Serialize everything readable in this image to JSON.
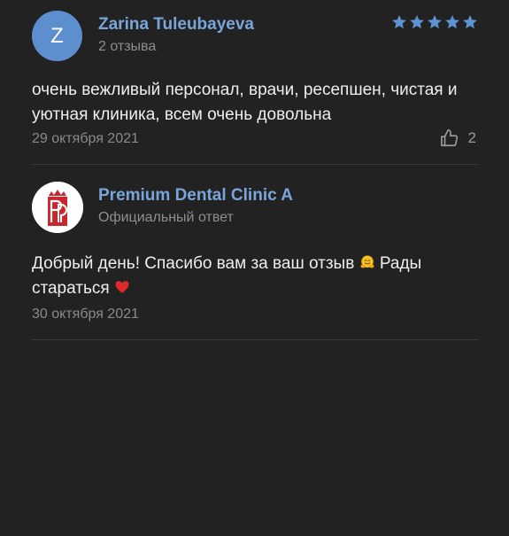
{
  "review": {
    "avatar_letter": "Z",
    "author": "Zarina Tuleubayeva",
    "author_reviews": "2 отзыва",
    "rating": 5,
    "text": "очень вежливый персонал, врачи, ресепшен, чистая и уютная клиника, всем очень довольна",
    "date": "29 октября 2021",
    "likes": "2"
  },
  "reply": {
    "author": "Premium Dental Clinic A",
    "subtitle": "Официальный ответ",
    "text_part1": "Добрый день! Спасибо вам за ваш отзыв",
    "text_part2": "Рады стараться",
    "date": "30 октября 2021"
  },
  "colors": {
    "background": "#222222",
    "name": "#79a6da",
    "avatar": "#5d8fcf",
    "stars": "#5e93d1",
    "logo_red": "#c8282d"
  },
  "icons": {
    "rating": "star-icon",
    "like": "thumbs-up-icon",
    "emoji_1": "hugging-face-emoji",
    "emoji_2": "red-heart-emoji"
  }
}
